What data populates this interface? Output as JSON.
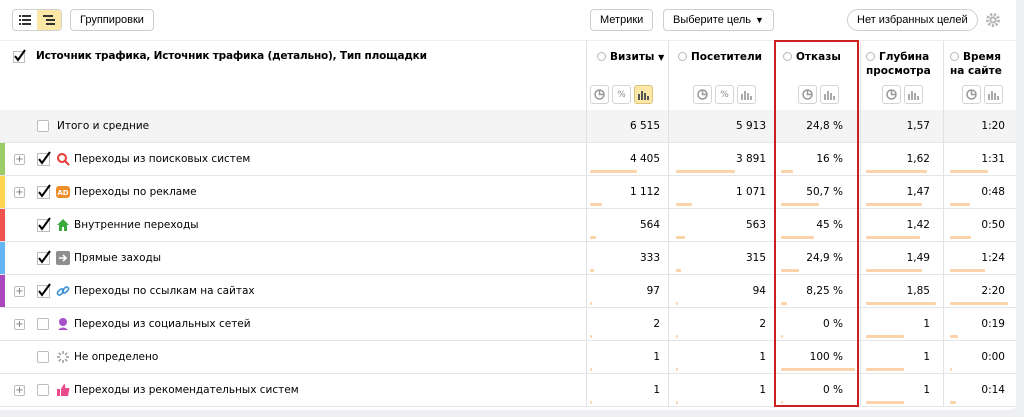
{
  "toolbar": {
    "group_label": "Группировки",
    "metrics_label": "Метрики",
    "goal_label": "Выберите цель",
    "fav_label": "Нет избранных целей"
  },
  "header": {
    "dimension_title": "Источник трафика, Источник трафика (детально), Тип площадки",
    "columns": {
      "visits": "Визиты",
      "visitors": "Посетители",
      "bounces": "Отказы",
      "depth": "Глубина просмотра",
      "time": "Время на сайте"
    },
    "sort_arrow": "▼"
  },
  "rows": [
    {
      "label": "Итого и средние",
      "visits": "6 515",
      "visitors": "5 913",
      "bounces": "24,8 %",
      "depth": "1,57",
      "time": "1:20",
      "icon": "none",
      "checked": false,
      "expandable": false,
      "stripe": ""
    },
    {
      "label": "Переходы из поисковых систем",
      "visits": "4 405",
      "visitors": "3 891",
      "bounces": "16 %",
      "depth": "1,62",
      "time": "1:31",
      "icon": "search-icon",
      "checked": true,
      "expandable": true,
      "stripe": "#9ccc65"
    },
    {
      "label": "Переходы по рекламе",
      "visits": "1 112",
      "visitors": "1 071",
      "bounces": "50,7 %",
      "depth": "1,47",
      "time": "0:48",
      "icon": "ad-icon",
      "checked": true,
      "expandable": true,
      "stripe": "#ffd54f"
    },
    {
      "label": "Внутренние переходы",
      "visits": "564",
      "visitors": "563",
      "bounces": "45 %",
      "depth": "1,42",
      "time": "0:50",
      "icon": "home-icon",
      "checked": true,
      "expandable": false,
      "stripe": "#ef5350"
    },
    {
      "label": "Прямые заходы",
      "visits": "333",
      "visitors": "315",
      "bounces": "24,9 %",
      "depth": "1,49",
      "time": "1:24",
      "icon": "arrow-icon",
      "checked": true,
      "expandable": false,
      "stripe": "#64b5f6"
    },
    {
      "label": "Переходы по ссылкам на сайтах",
      "visits": "97",
      "visitors": "94",
      "bounces": "8,25 %",
      "depth": "1,85",
      "time": "2:20",
      "icon": "link-icon",
      "checked": true,
      "expandable": true,
      "stripe": "#ab47bc"
    },
    {
      "label": "Переходы из социальных сетей",
      "visits": "2",
      "visitors": "2",
      "bounces": "0 %",
      "depth": "1",
      "time": "0:19",
      "icon": "social-icon",
      "checked": false,
      "expandable": true,
      "stripe": ""
    },
    {
      "label": "Не определено",
      "visits": "1",
      "visitors": "1",
      "bounces": "100 %",
      "depth": "1",
      "time": "0:00",
      "icon": "spinner-icon",
      "checked": false,
      "expandable": false,
      "stripe": ""
    },
    {
      "label": "Переходы из рекомендательных систем",
      "visits": "1",
      "visitors": "1",
      "bounces": "0 %",
      "depth": "1",
      "time": "0:14",
      "icon": "thumb-icon",
      "checked": false,
      "expandable": true,
      "stripe": ""
    }
  ],
  "colors": {
    "accent": "#fce8a6",
    "bar": "#fbd2a9",
    "highlight": "#cc1f1f"
  }
}
